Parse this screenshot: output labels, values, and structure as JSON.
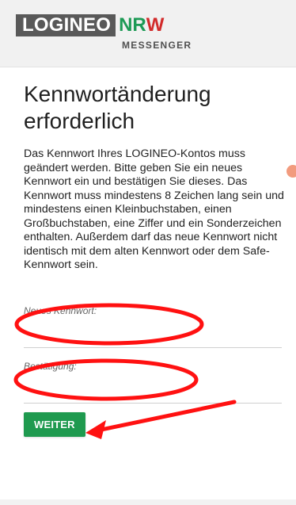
{
  "header": {
    "brand_main": "LOGINEO",
    "brand_nr": "NR",
    "brand_w": "W",
    "brand_sub": "MESSENGER"
  },
  "main": {
    "title": "Kennwortänderung erforderlich",
    "description": "Das Kennwort Ihres LOGINEO-Kontos muss geändert werden. Bitte geben Sie ein neues Kennwort ein und bestätigen Sie dieses. Das Kennwort muss mindestens 8 Zeichen lang sein und mindestens einen Kleinbuchstaben, einen Großbuchstaben, eine Ziffer und ein Sonderzeichen enthalten. Außerdem darf das neue Kennwort nicht identisch mit dem alten Kennwort oder dem Safe-Kennwort sein."
  },
  "form": {
    "new_password_label": "Neues Kennwort:",
    "new_password_value": "",
    "confirmation_label": "Bestätigung:",
    "confirmation_value": "",
    "submit_label": "WEITER"
  },
  "icons": {
    "side_handle": "scroll-handle-icon",
    "annotation_arrow": "red-arrow-icon"
  },
  "colors": {
    "brand_green": "#1d9a55",
    "brand_red": "#d22b2b",
    "button_green": "#1f9a4f",
    "annotation_red": "#ff1111",
    "header_gray": "#595959"
  }
}
